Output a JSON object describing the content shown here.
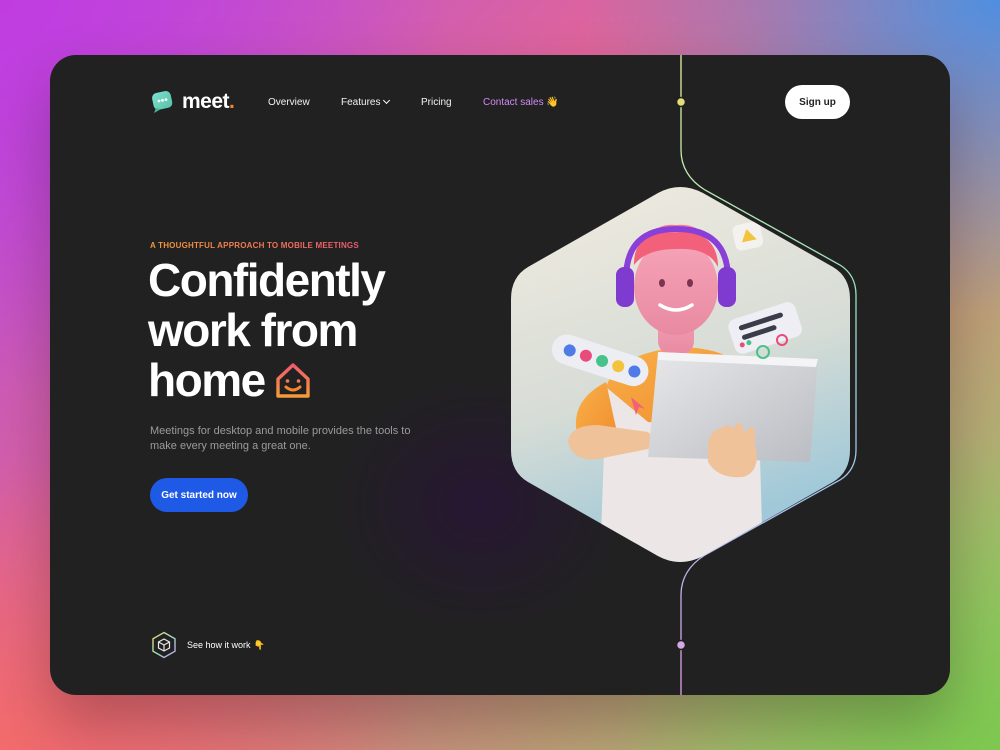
{
  "brand": {
    "name": "meet",
    "dot": "."
  },
  "nav": {
    "items": [
      {
        "label": "Overview"
      },
      {
        "label": "Features"
      },
      {
        "label": "Pricing"
      },
      {
        "label": "Contact sales",
        "emoji": "👋"
      }
    ],
    "signup_label": "Sign up"
  },
  "hero": {
    "eyebrow": "A THOUGHTFUL APPROACH TO MOBILE MEETINGS",
    "headline": [
      "Confidently",
      "work from",
      "home"
    ],
    "subtitle": "Meetings for desktop and mobile provides the tools to make every meeting a great one.",
    "cta_label": "Get started now",
    "see_label": "See how it work",
    "see_emoji": "👇"
  },
  "colors": {
    "card_bg": "#212121",
    "cta_blue": "#1f5ae6",
    "accent_orange": "#f5862e",
    "contact_purple": "#d08bf6"
  },
  "icons": [
    "chat-bubble-logo-icon",
    "chevron-down-icon",
    "smiling-house-icon",
    "cube-icon"
  ]
}
